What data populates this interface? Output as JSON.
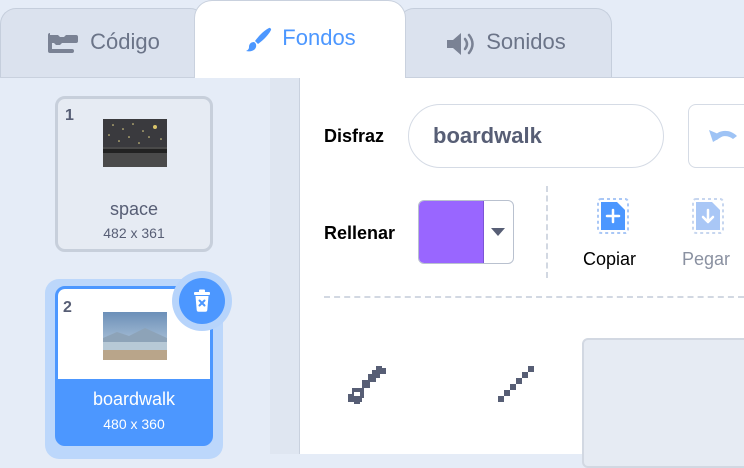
{
  "tabs": {
    "code": {
      "label": "Código",
      "icon": "code-blocks-icon"
    },
    "backdrops": {
      "label": "Fondos",
      "icon": "paintbrush-icon",
      "active": true
    },
    "sounds": {
      "label": "Sonidos",
      "icon": "speaker-icon"
    }
  },
  "costumes": [
    {
      "number": "1",
      "name": "space",
      "size": "482 x 361"
    },
    {
      "number": "2",
      "name": "boardwalk",
      "size": "480 x 360",
      "selected": true
    }
  ],
  "editor": {
    "costume_label": "Disfraz",
    "costume_name": "boardwalk",
    "fill_label": "Rellenar",
    "fill_color": "#9966ff",
    "copy_label": "Copiar",
    "paste_label": "Pegar"
  },
  "colors": {
    "accent": "#4c97ff",
    "text": "#575e75",
    "panel_bg": "#e5ecf7"
  }
}
